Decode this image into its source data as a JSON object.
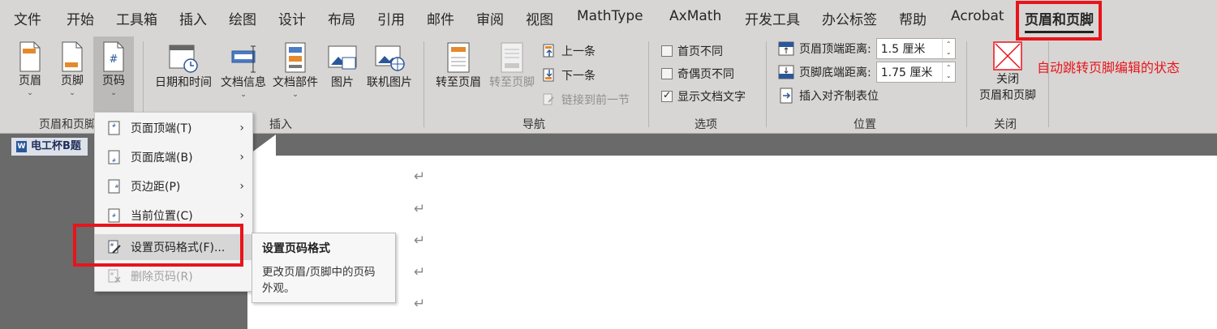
{
  "tabs": [
    "文件",
    "开始",
    "工具箱",
    "插入",
    "绘图",
    "设计",
    "布局",
    "引用",
    "邮件",
    "审阅",
    "视图",
    "MathType",
    "AxMath",
    "开发工具",
    "办公标签",
    "帮助",
    "Acrobat",
    "页眉和页脚"
  ],
  "ribbon": {
    "groups": {
      "header_footer": "页眉和页脚",
      "insert": "插入",
      "navigation": "导航",
      "options": "选项",
      "position": "位置",
      "close": "关闭"
    },
    "header_btn": "页眉",
    "footer_btn": "页脚",
    "pagenum_btn": "页码",
    "datetime_btn": "日期和时间",
    "docinfo_btn": "文档信息",
    "docparts_btn": "文档部件",
    "picture_btn": "图片",
    "onlinepic_btn": "联机图片",
    "goto_header_btn": "转至页眉",
    "goto_footer_btn": "转至页脚",
    "prev_btn": "上一条",
    "next_btn": "下一条",
    "link_prev_btn": "链接到前一节",
    "diff_first": "首页不同",
    "diff_oddeven": "奇偶页不同",
    "show_doc_text": "显示文档文字",
    "header_top_label": "页眉顶端距离:",
    "header_top_value": "1.5 厘米",
    "footer_bottom_label": "页脚底端距离:",
    "footer_bottom_value": "1.75 厘米",
    "insert_align_tab": "插入对齐制表位",
    "close_btn_line1": "关闭",
    "close_btn_line2": "页眉和页脚"
  },
  "doc_tab": "电工杯B题",
  "menu": {
    "items": [
      {
        "label": "页面顶端(T)",
        "submenu": true
      },
      {
        "label": "页面底端(B)",
        "submenu": true
      },
      {
        "label": "页边距(P)",
        "submenu": true
      },
      {
        "label": "当前位置(C)",
        "submenu": true
      },
      {
        "label": "设置页码格式(F)...",
        "submenu": false
      },
      {
        "label": "删除页码(R)",
        "submenu": false
      }
    ]
  },
  "tooltip": {
    "title": "设置页码格式",
    "desc": "更改页眉/页脚中的页码外观。"
  },
  "annotation": "自动跳转页脚编辑的状态",
  "paragraph_mark": "↵",
  "colors": {
    "accent_red": "#e8141b",
    "ribbon_bg": "#d8d6d4",
    "word_blue": "#2b579a"
  }
}
